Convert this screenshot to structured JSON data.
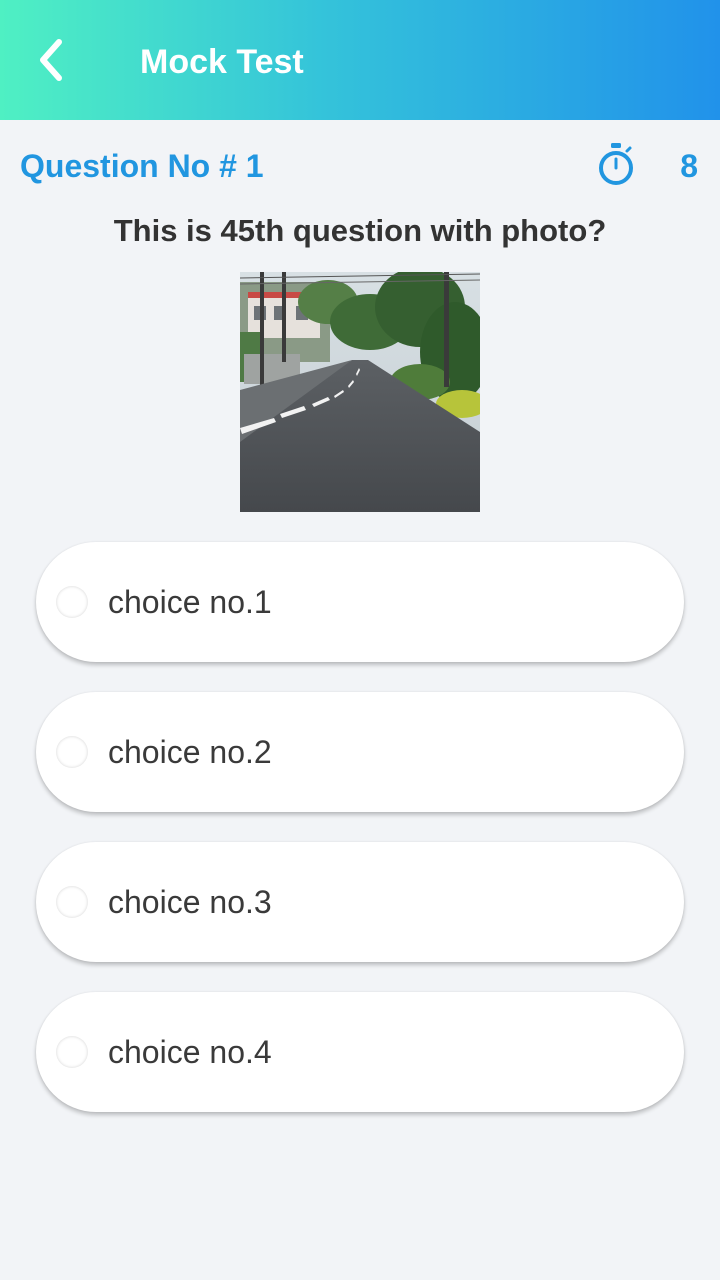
{
  "header": {
    "title": "Mock Test",
    "back_icon": "chevron-left-icon",
    "gradient": [
      "#4ff0c3",
      "#34c3da",
      "#2192ea"
    ]
  },
  "question": {
    "number_label": "Question No # 1",
    "timer_icon": "stopwatch-icon",
    "timer_value": "8",
    "text": "This is 45th question with photo?",
    "photo": "road-scene-photo"
  },
  "choices": [
    {
      "label": "choice no.1"
    },
    {
      "label": "choice no.2"
    },
    {
      "label": "choice no.3"
    },
    {
      "label": "choice no.4"
    }
  ],
  "colors": {
    "accent": "#2196e0",
    "background": "#f2f4f7",
    "text": "#333333"
  }
}
